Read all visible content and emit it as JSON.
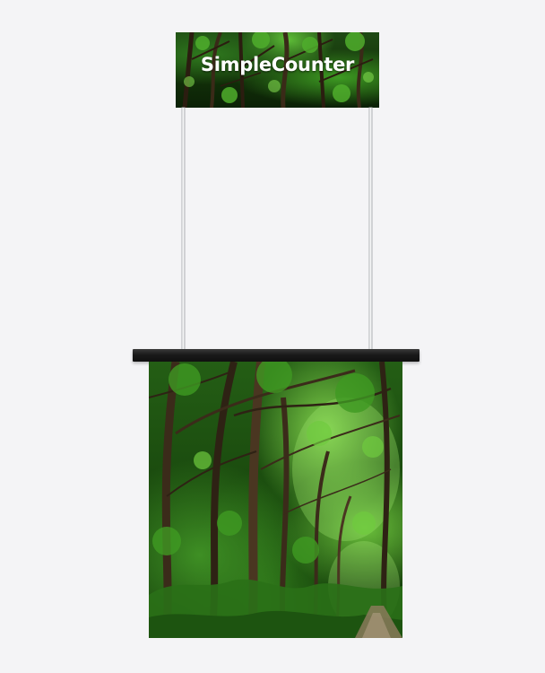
{
  "brand": {
    "name": "SimpleCounter"
  },
  "scene": {
    "background_color": "#f4f4f6",
    "countertop_color": "#1a1a1a",
    "foliage_color": "#2f7a1e"
  }
}
